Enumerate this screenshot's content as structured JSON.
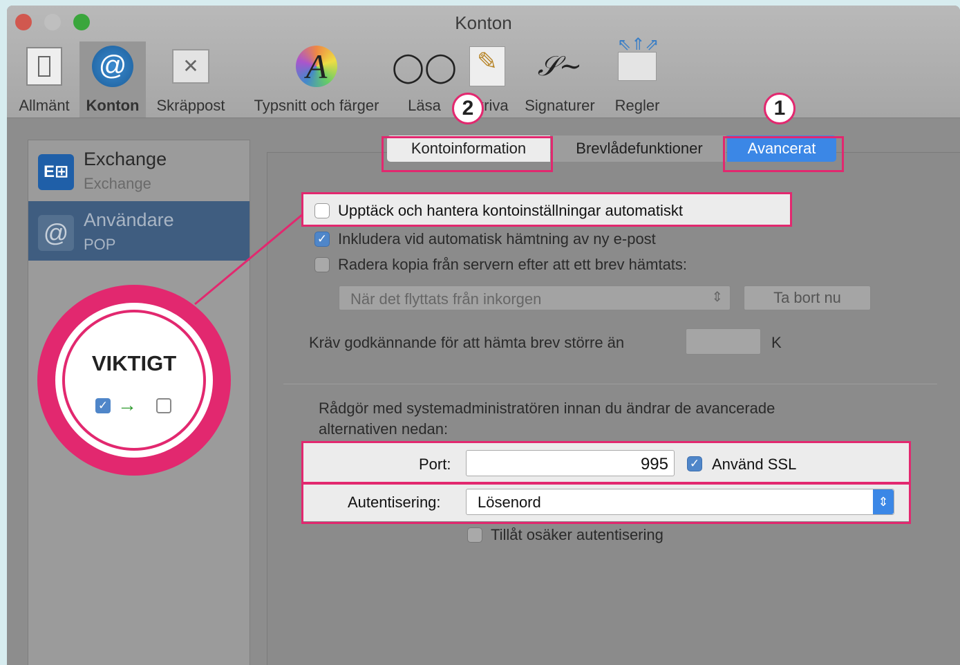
{
  "window": {
    "title": "Konton"
  },
  "toolbar": [
    {
      "label": "Allmänt",
      "icon": "switch-icon"
    },
    {
      "label": "Konton",
      "icon": "at-sign-icon"
    },
    {
      "label": "Skräppost",
      "icon": "junk-bin-icon"
    },
    {
      "label": "Typsnitt och färger",
      "icon": "font-color-icon"
    },
    {
      "label": "Läsa",
      "icon": "glasses-icon"
    },
    {
      "label": "Skriva",
      "icon": "pencil-icon"
    },
    {
      "label": "Signaturer",
      "icon": "signature-icon"
    },
    {
      "label": "Regler",
      "icon": "rules-envelope-icon"
    }
  ],
  "accounts": [
    {
      "name": "Exchange",
      "type": "Exchange",
      "icon": "exchange-icon"
    },
    {
      "name": "Användare",
      "type": "POP",
      "icon": "at-sign-icon"
    }
  ],
  "tabs": [
    {
      "label": "Kontoinformation",
      "callout": "2"
    },
    {
      "label": "Brevlådefunktioner"
    },
    {
      "label": "Avancerat",
      "callout": "1"
    }
  ],
  "options": {
    "auto_detect": {
      "label": "Upptäck och hantera kontoinställningar automatiskt",
      "checked": false
    },
    "include_fetch": {
      "label": "Inkludera vid automatisk hämtning av ny e-post",
      "checked": true
    },
    "delete_copy": {
      "label": "Radera kopia från servern efter att ett brev hämtats:",
      "checked": false
    },
    "delete_when": "När det flyttats från inkorgen",
    "remove_now": "Ta bort nu",
    "require_approval": "Kräv godkännande för att hämta brev större än",
    "size_unit": "K"
  },
  "advanced": {
    "note": "Rådgör med systemadministratören innan du ändrar de avancerade alternativen nedan:",
    "port_label": "Port:",
    "port_value": "995",
    "ssl_label": "Använd SSL",
    "ssl_checked": true,
    "auth_label": "Autentisering:",
    "auth_value": "Lösenord",
    "insecure_label": "Tillåt osäker autentisering",
    "insecure_checked": false
  },
  "annotation": {
    "title": "VIKTIGT",
    "accent": "#e2286f"
  }
}
